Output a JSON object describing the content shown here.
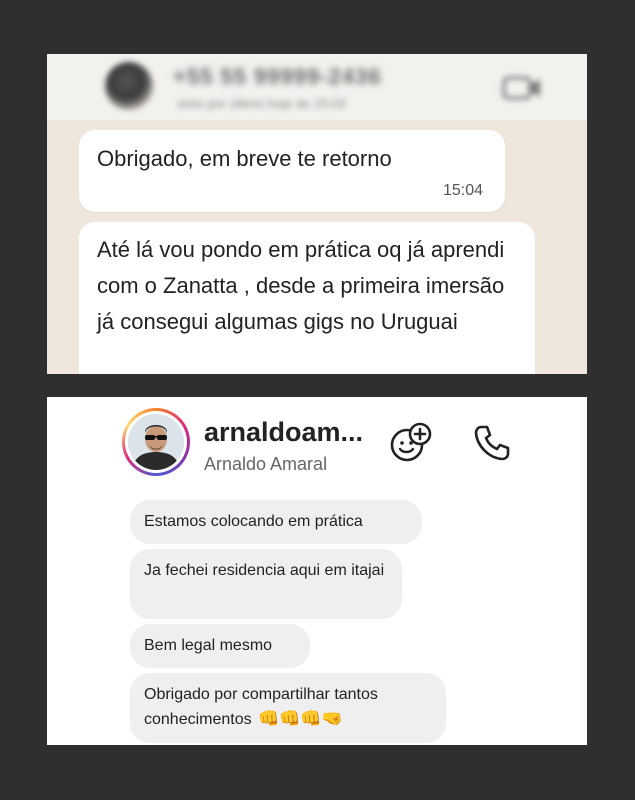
{
  "whatsapp": {
    "header": {
      "contact_name": "+55 55 99999-2436",
      "contact_status": "visto por último hoje às 15:02",
      "video_icon": "video-camera-icon"
    },
    "messages": [
      {
        "text": "Obrigado, em breve te retorno",
        "time": "15:04"
      },
      {
        "text": "Até lá vou pondo em prática oq já aprendi com o Zanatta , desde a primeira imersão já consegui algumas gigs no Uruguai"
      }
    ],
    "colors": {
      "chat_bg": "#efe7dc",
      "bubble": "#ffffff",
      "header_bg": "#f3f1ee"
    }
  },
  "instagram": {
    "header": {
      "username": "arnaldoam...",
      "full_name": "Arnaldo Amaral",
      "video_icon": "video-chat-icon",
      "call_icon": "phone-icon"
    },
    "messages": [
      {
        "text": "Estamos colocando em prática"
      },
      {
        "text": "Ja fechei residencia aqui em itajai"
      },
      {
        "text": "Bem legal mesmo"
      },
      {
        "text": "Obrigado por compartilhar tantos conhecimentos",
        "emojis": "👊👊👊🤜"
      }
    ],
    "colors": {
      "bubble": "#efeff1",
      "panel_bg": "#ffffff"
    }
  },
  "page": {
    "background": "#2f2f2f"
  }
}
